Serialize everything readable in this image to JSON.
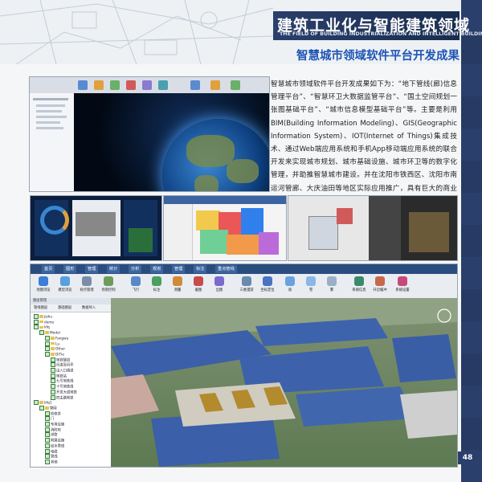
{
  "header": {
    "title": "建筑工业化与智能建筑领域",
    "subtitle": "THE FIELD OF BUILDING INDUSTRIALIZATION AND INTELLIGENT BUILDINGS",
    "section_title": "智慧城市领域软件平台开发成果"
  },
  "article": {
    "paragraph": "智慧城市领域软件平台开发成果如下为：“地下管线(廊)信息管理平台”、“智慧环卫大数据监管平台”、“国土空间规划一张图基础平台”、“城市信息模型基础平台”等。主要是利用BIM(Building Information Modeling)、GIS(Geographic Information System)、IOT(Internet of Things)集成技术、通过Web端应用系统和手机App移动端应用系统的联合开发来实现城市规划、城市基础设施、城市环卫等的数字化管理，并助推智慧城市建设。并在沈阳市铁西区、沈阳市南运河管廊、大庆油田等地区实际应用推广，具有巨大的商业价值。"
  },
  "page_number": "48",
  "app": {
    "menu": [
      "首页",
      "图形",
      "管理",
      "统计",
      "分析",
      "规划",
      "管理",
      "标注",
      "重点管线"
    ],
    "ribbon": [
      {
        "label": "地图浏览",
        "color": "#3b7dd8"
      },
      {
        "label": "模型浏览",
        "color": "#58a0e0"
      },
      {
        "label": "视点管理",
        "color": "#7b8ea8"
      },
      {
        "label": "场景控制",
        "color": "#6d9c5a"
      },
      {
        "label": "飞行",
        "color": "#5a87c8"
      },
      {
        "label": "标注",
        "color": "#4aa060"
      },
      {
        "label": "测量",
        "color": "#d08a3a"
      },
      {
        "label": "截图",
        "color": "#c84a4a"
      },
      {
        "label": "出图",
        "color": "#7a6ad0"
      },
      {
        "label": "三维漫游",
        "color": "#6a8ab0"
      },
      {
        "label": "坐标定位",
        "color": "#4a74c0"
      },
      {
        "label": "雨",
        "color": "#6aa2e0"
      },
      {
        "label": "雪",
        "color": "#8ab6e8"
      },
      {
        "label": "雾",
        "color": "#9ab0c8"
      },
      {
        "label": "系统信息",
        "color": "#3a8a6a"
      },
      {
        "label": "开启缓冲",
        "color": "#c8684a"
      },
      {
        "label": "系统设置",
        "color": "#c84a7a"
      }
    ],
    "ribbon_groups": [
      "浏览模式",
      "漫游",
      "定位",
      "特效",
      "设置"
    ],
    "tree": {
      "header": "图层管理",
      "tabs": [
        "管线图层",
        "基础图层",
        "数据导入"
      ],
      "rows": [
        {
          "text": "jizhu",
          "indent": 0,
          "folder": true
        },
        {
          "text": "demo",
          "indent": 0,
          "folder": true
        },
        {
          "text": "kfq",
          "indent": 0,
          "folder": true
        },
        {
          "text": "Model",
          "indent": 1,
          "folder": true
        },
        {
          "text": "Fangwu",
          "indent": 2,
          "folder": true
        },
        {
          "text": "Lu",
          "indent": 2,
          "folder": true
        },
        {
          "text": "Other",
          "indent": 2,
          "folder": true
        },
        {
          "text": "DiTie",
          "indent": 2,
          "folder": true
        },
        {
          "text": "地铁隧道",
          "indent": 3,
          "folder": false
        },
        {
          "text": "风道及风亭",
          "indent": 3,
          "folder": false
        },
        {
          "text": "出入口通道",
          "indent": 3,
          "folder": false
        },
        {
          "text": "地铁站",
          "indent": 3,
          "folder": false
        },
        {
          "text": "七号地铁线",
          "indent": 3,
          "folder": false
        },
        {
          "text": "十号地铁线",
          "indent": 3,
          "folder": false
        },
        {
          "text": "开发大道地铁",
          "indent": 3,
          "folder": false
        },
        {
          "text": "四主路地铁",
          "indent": 3,
          "folder": false
        },
        {
          "text": "kfq1",
          "indent": 0,
          "folder": true
        },
        {
          "text": "管网",
          "indent": 1,
          "folder": true
        },
        {
          "text": "检修井",
          "indent": 2,
          "folder": false
        },
        {
          "text": "门",
          "indent": 2,
          "folder": false
        },
        {
          "text": "专用设施",
          "indent": 2,
          "folder": false
        },
        {
          "text": "消防栓",
          "indent": 2,
          "folder": false
        },
        {
          "text": "排管",
          "indent": 2,
          "folder": false
        },
        {
          "text": "附属设施",
          "indent": 2,
          "folder": false
        },
        {
          "text": "给水管线",
          "indent": 2,
          "folder": false
        },
        {
          "text": "电缆",
          "indent": 2,
          "folder": false
        },
        {
          "text": "管线",
          "indent": 2,
          "folder": false
        },
        {
          "text": "其他",
          "indent": 2,
          "folder": false
        }
      ]
    }
  },
  "colors": {
    "banner": "#2a3f6b",
    "section_title": "#1e55b4",
    "accent": "#3b64a0"
  }
}
